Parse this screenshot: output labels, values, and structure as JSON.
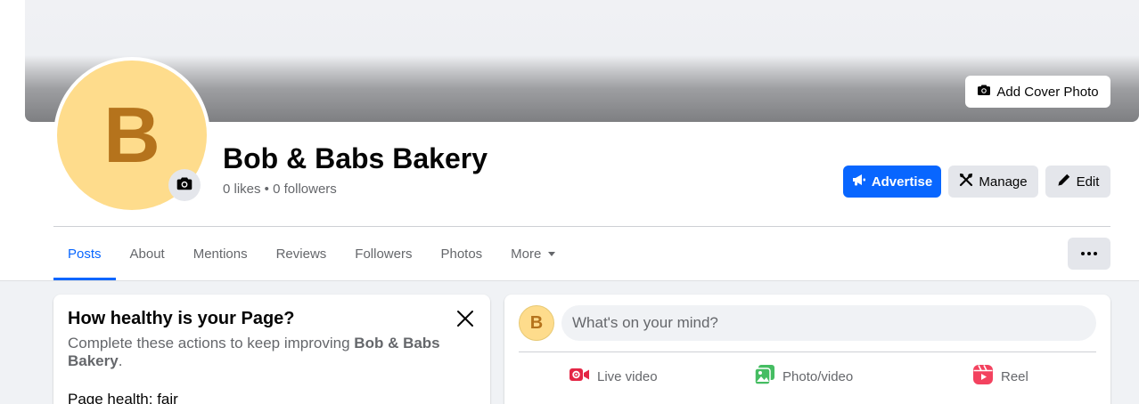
{
  "cover": {
    "add_cover_label": "Add Cover Photo",
    "icon": "camera-icon"
  },
  "profile": {
    "avatar_letter": "B",
    "avatar_color": "#fedc8c",
    "avatar_letter_color": "#b5731c",
    "name": "Bob & Babs Bakery",
    "stats": "0 likes • 0 followers",
    "camera_icon": "camera-icon"
  },
  "actions": {
    "advertise": {
      "label": "Advertise",
      "icon": "megaphone-icon",
      "color": "#0866ff"
    },
    "manage": {
      "label": "Manage",
      "icon": "tools-icon"
    },
    "edit": {
      "label": "Edit",
      "icon": "pencil-icon"
    }
  },
  "tabs": [
    {
      "label": "Posts",
      "active": true
    },
    {
      "label": "About",
      "active": false
    },
    {
      "label": "Mentions",
      "active": false
    },
    {
      "label": "Reviews",
      "active": false
    },
    {
      "label": "Followers",
      "active": false
    },
    {
      "label": "Photos",
      "active": false
    },
    {
      "label": "More",
      "active": false
    }
  ],
  "more_options_icon": "more-dots-icon",
  "health_card": {
    "title": "How healthy is your Page?",
    "desc_prefix": "Complete these actions to keep improving ",
    "desc_page_name": "Bob & Babs Bakery",
    "desc_suffix": ".",
    "status": "Page health: fair",
    "close_icon": "close-icon"
  },
  "composer": {
    "avatar_letter": "B",
    "placeholder": "What's on your mind?",
    "actions": [
      {
        "label": "Live video",
        "icon": "live-video-icon",
        "color": "#e42645"
      },
      {
        "label": "Photo/video",
        "icon": "photo-icon",
        "color": "#45bd62"
      },
      {
        "label": "Reel",
        "icon": "reel-icon",
        "color": "#f3425f"
      }
    ]
  }
}
